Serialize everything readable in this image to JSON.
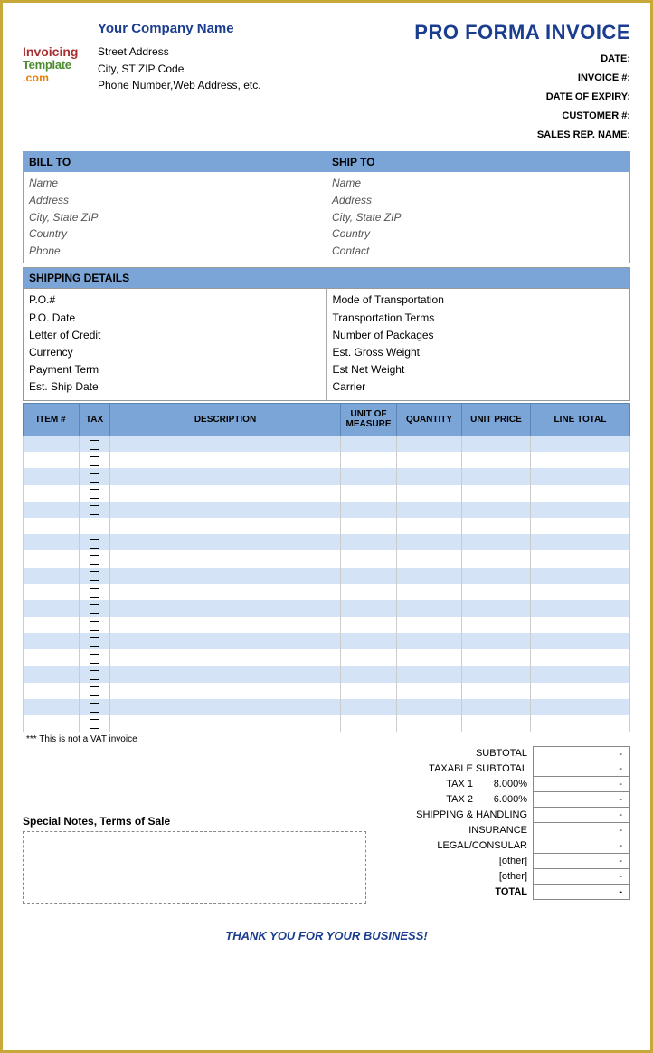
{
  "logo": {
    "line1": "Invoicing",
    "line2": "Template",
    "line3": ".com"
  },
  "company": {
    "name": "Your Company Name",
    "street": "Street Address",
    "city": "City, ST  ZIP Code",
    "contact": "Phone Number,Web Address, etc."
  },
  "title": "PRO FORMA INVOICE",
  "meta": {
    "date": "DATE:",
    "invoice": "INVOICE #:",
    "expiry": "DATE OF EXPIRY:",
    "customer": "CUSTOMER #:",
    "salesrep": "SALES REP. NAME:"
  },
  "billto": {
    "head": "BILL TO",
    "name": "Name",
    "address": "Address",
    "city": "City, State ZIP",
    "country": "Country",
    "phone": "Phone"
  },
  "shipto": {
    "head": "SHIP TO",
    "name": "Name",
    "address": "Address",
    "city": "City, State ZIP",
    "country": "Country",
    "contact": "Contact"
  },
  "shipping": {
    "head": "SHIPPING DETAILS",
    "left": [
      "P.O.#",
      "P.O. Date",
      "Letter of Credit",
      "Currency",
      "Payment Term",
      "Est. Ship Date"
    ],
    "right": [
      "Mode of Transportation",
      "Transportation Terms",
      "Number of Packages",
      "Est. Gross Weight",
      "Est Net Weight",
      "Carrier"
    ]
  },
  "columns": {
    "item": "ITEM #",
    "tax": "TAX",
    "desc": "DESCRIPTION",
    "unit": "UNIT OF MEASURE",
    "qty": "QUANTITY",
    "price": "UNIT PRICE",
    "total": "LINE TOTAL"
  },
  "vat_note": "*** This is not a VAT invoice",
  "totals": {
    "subtotal": "SUBTOTAL",
    "taxable": "TAXABLE SUBTOTAL",
    "tax1_label": "TAX 1",
    "tax1_pct": "8.000%",
    "tax2_label": "TAX 2",
    "tax2_pct": "6.000%",
    "shipping": "SHIPPING & HANDLING",
    "insurance": "INSURANCE",
    "legal": "LEGAL/CONSULAR",
    "other1": "[other]",
    "other2": "[other]",
    "total": "TOTAL",
    "dash": "-"
  },
  "special": {
    "label": "Special Notes, Terms of Sale"
  },
  "thanks": "THANK YOU FOR YOUR BUSINESS!"
}
